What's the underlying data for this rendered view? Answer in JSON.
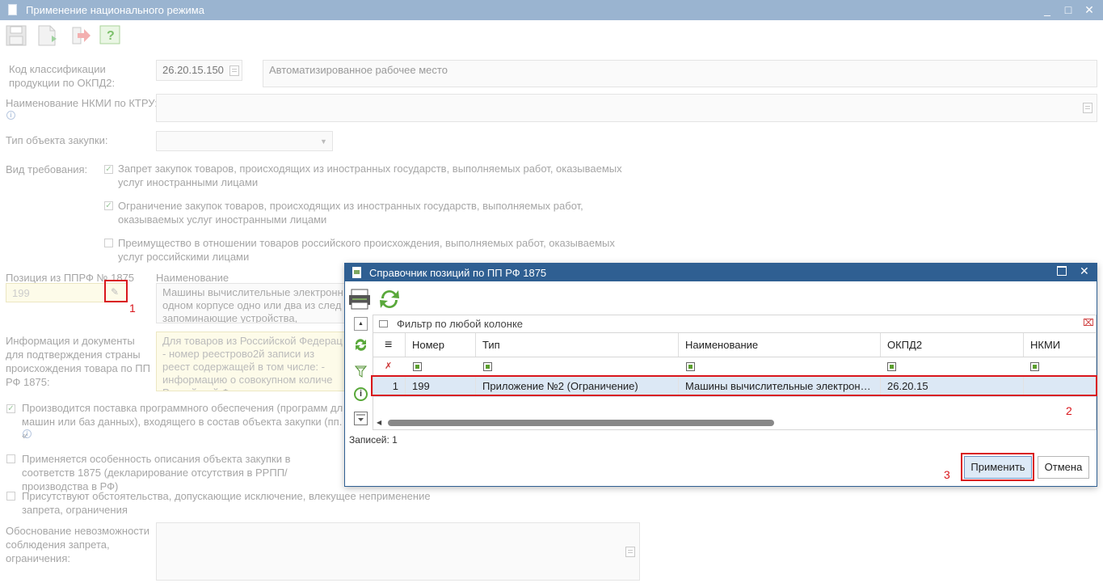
{
  "window": {
    "title": "Применение национального режима",
    "min": "_",
    "max": "□",
    "close": "✕"
  },
  "toolbar": {
    "icons": [
      "save-icon",
      "document-icon",
      "arrow-right-icon",
      "help-icon"
    ],
    "help_glyph": "?"
  },
  "form": {
    "okpd_label": "Код классификации продукции по ОКПД2:",
    "okpd_code": "26.20.15.150",
    "okpd_name": "Автоматизированное рабочее место",
    "nkmi_label": "Наименование НКМИ по КТРУ:",
    "type_label": "Тип объекта закупки:",
    "req_label": "Вид требования:",
    "req_options": [
      {
        "text": "Запрет закупок товаров, происходящих из иностранных государств, выполняемых работ, оказываемых услуг иностранными лицами",
        "checked": true
      },
      {
        "text": "Ограничение закупок товаров, происходящих из иностранных государств, выполняемых работ, оказываемых услуг иностранными лицами",
        "checked": true
      },
      {
        "text": "Преимущество в отношении товаров российского происхождения, выполняемых работ, оказываемых услуг российскими лицами",
        "checked": false
      }
    ],
    "pos_label": "Позиция из ППРФ № 1875",
    "pos_value": "199",
    "name_label": "Наименование",
    "name_value": "Машины вычислительные электронн одном корпусе одно или два из след запоминающие устройства, устройств",
    "docs_label": "Информация и документы для подтверждения страны происхождения товара по ПП РФ 1875:",
    "docs_value": "Для товаров из Российской Федерац - номер реестрово2й записи из реест содержащей в том числе: - информацию о совокупном количе Российской Федерации соответствую",
    "software_text": "Производится поставка программного обеспечения (программ дл машин или баз данных), входящего в состав объекта закупки (пп. «",
    "software_checked": true,
    "feature_text": "Применяется особенность описания объекта закупки в соответств 1875 (декларирование отсутствия в РРПП/производства в РФ)",
    "feature_checked": false,
    "circumstance_text": "Присутствуют обстоятельства, допускающие исключение, влекущее неприменение запрета, ограничения",
    "circumstance_checked": false,
    "justification_label": "Обоснование невозможности соблюдения запрета, ограничения:"
  },
  "dialog": {
    "title": "Справочник позиций по ПП РФ 1875",
    "filter_placeholder": "Фильтр по любой колонке",
    "columns": [
      "Номер",
      "Тип",
      "Наименование",
      "ОКПД2",
      "НКМИ"
    ],
    "rows": [
      {
        "index": "1",
        "number": "199",
        "type": "Приложение №2 (Ограничение)",
        "name": "Машины вычислительные электрон…",
        "okpd2": "26.20.15",
        "nkmi": ""
      }
    ],
    "records_label": "Записей: 1",
    "apply_button": "Применить",
    "cancel_button": "Отмена"
  },
  "annotations": {
    "one": "1",
    "two": "2",
    "three": "3"
  },
  "colors": {
    "title_bar": "#9ab4d0",
    "dialog_title": "#2f5f92",
    "highlight": "#d9161c",
    "selected_row": "#dce8f5"
  }
}
